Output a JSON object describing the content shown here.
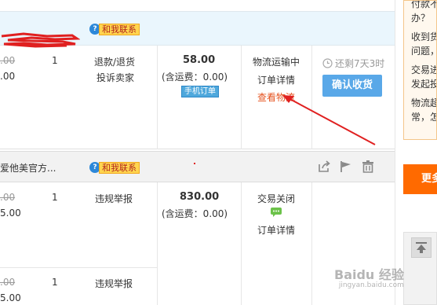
{
  "order1": {
    "contact_label": "和我联系",
    "unit_price": ".00",
    "unit_price_after": ".00",
    "quantity": "1",
    "aftersale": [
      "退款/退货",
      "投诉卖家"
    ],
    "total": "58.00",
    "shipping_note": "(含运费：0.00)",
    "mobile_tag": "手机订单",
    "status": "物流运输中",
    "detail_link": "订单详情",
    "logistics_link": "查看物流",
    "countdown": "还剩7天3时",
    "confirm_button": "确认收货"
  },
  "order2": {
    "shop_name": "爱他美官方...",
    "contact_label": "和我联系",
    "item1": {
      "unit_price": ".00",
      "unit_price_after": "5.00",
      "quantity": "1",
      "aftersale": "违规举报"
    },
    "item2": {
      "unit_price": ".00",
      "unit_price_after": "5.00",
      "quantity": "1",
      "aftersale": "违规举报"
    },
    "total": "830.00",
    "shipping_note": "(含运费：0.00)",
    "status": "交易关闭",
    "detail_link": "订单详情"
  },
  "side": {
    "notice_lines": [
      "付款不",
      "办？",
      "收到货",
      "问题，",
      "交易进",
      "发起投",
      "物流超",
      "常，怎"
    ],
    "more_button": "更多"
  },
  "watermark": {
    "brand": "Baidu 经验",
    "url": "jingyan.baidu.com"
  },
  "colors": {
    "accent_orange": "#ff6a00",
    "link_orange": "#e5511d",
    "button_blue": "#59a8e8",
    "header_blue": "#eaf6fd",
    "annotation_red": "#e02020"
  },
  "icons": [
    "clock-icon",
    "share-icon",
    "flag-icon",
    "trash-icon",
    "chat-icon",
    "to-top-icon"
  ]
}
